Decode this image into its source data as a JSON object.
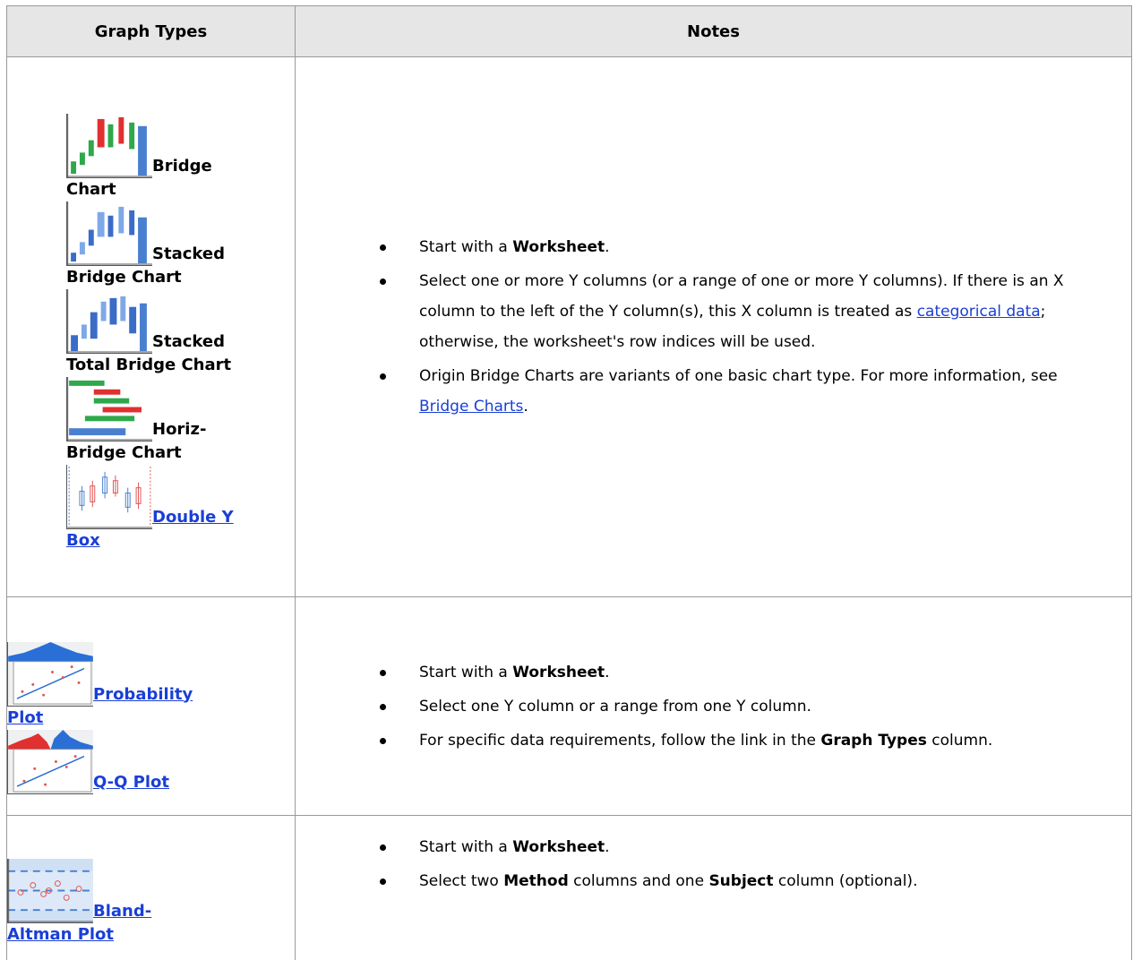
{
  "header": {
    "col1": "Graph Types",
    "col2": "Notes"
  },
  "rows": [
    {
      "items": [
        {
          "label": "Bridge Chart",
          "icon": "bridge-chart-icon",
          "link": false
        },
        {
          "label": "Stacked Bridge Chart",
          "icon": "stacked-bridge-chart-icon",
          "link": false
        },
        {
          "label": "Stacked Total Bridge Chart",
          "icon": "stacked-total-bridge-chart-icon",
          "link": false
        },
        {
          "label": "Horiz-Bridge Chart",
          "icon": "horiz-bridge-chart-icon",
          "link": false
        },
        {
          "label": "Double Y Box",
          "icon": "double-y-box-icon",
          "link": true
        }
      ],
      "notes": {
        "n1_pre": "Start with a ",
        "n1_bold": "Worksheet",
        "n1_post": ".",
        "n2_pre": "Select one or more Y columns (or a range of one or more Y columns). If there is an X column to the left of the Y column(s), this X column is treated as ",
        "n2_link": "categorical data",
        "n2_post": "; otherwise, the worksheet's row indices will be used.",
        "n3_pre": "Origin Bridge Charts are variants of one basic chart type. For more information, see ",
        "n3_link": "Bridge Charts",
        "n3_post": "."
      }
    },
    {
      "items": [
        {
          "label": "Probability Plot",
          "icon": "probability-plot-icon",
          "link": true
        },
        {
          "label": "Q-Q Plot",
          "icon": "qq-plot-icon",
          "link": true
        }
      ],
      "notes": {
        "n1_pre": "Start with a ",
        "n1_bold": "Worksheet",
        "n1_post": ".",
        "n2": "Select one Y column or a range from one Y column.",
        "n3_pre": "For specific data requirements, follow the link in the ",
        "n3_bold": "Graph Types",
        "n3_post": " column."
      }
    },
    {
      "items": [
        {
          "label": "Bland-Altman Plot",
          "icon": "bland-altman-plot-icon",
          "link": true
        }
      ],
      "notes": {
        "n1_pre": "Start with a ",
        "n1_bold": "Worksheet",
        "n1_post": ".",
        "n2_pre": "Select two ",
        "n2_bold1": "Method",
        "n2_mid": " columns and one ",
        "n2_bold2": "Subject",
        "n2_post": " column (optional)."
      }
    }
  ],
  "colors": {
    "link": "#1a3fd6",
    "header_bg": "#e6e6e6",
    "border": "#999999"
  }
}
